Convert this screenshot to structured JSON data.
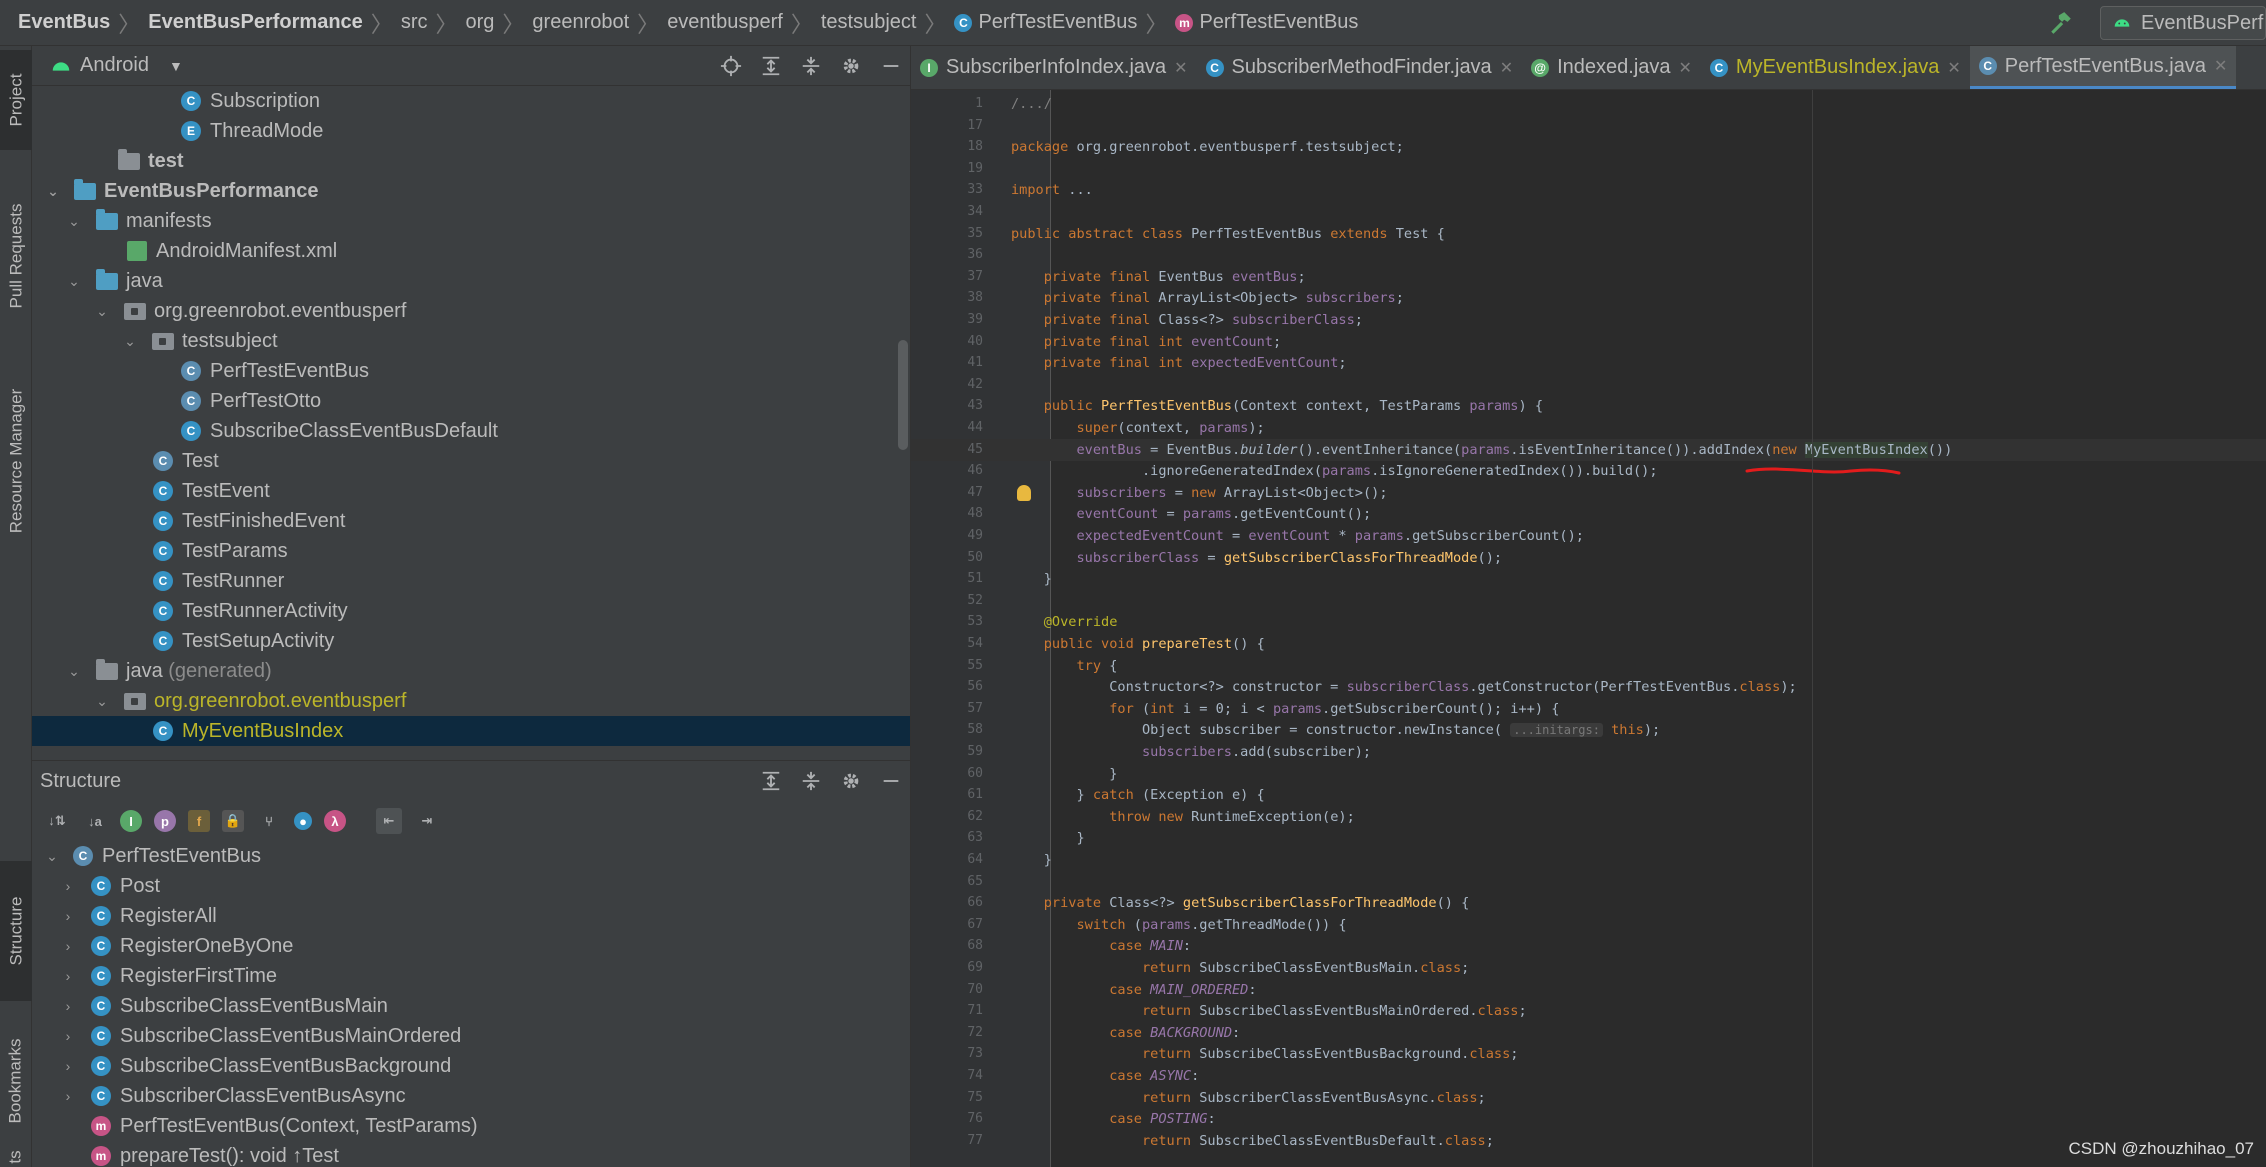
{
  "breadcrumb": [
    "EventBus",
    "EventBusPerformance",
    "src",
    "org",
    "greenrobot",
    "eventbusperf",
    "testsubject",
    "PerfTestEventBus",
    "PerfTestEventBus"
  ],
  "run_config": "EventBusPerf",
  "side_tabs": {
    "project": "Project",
    "pull_requests": "Pull Requests",
    "resource_manager": "Resource Manager",
    "structure": "Structure",
    "bookmarks": "Bookmarks",
    "bottom": "ts"
  },
  "project": {
    "view_mode": "Android",
    "tree": [
      {
        "label": "Subscription",
        "icon": "class-icon"
      },
      {
        "label": "ThreadMode",
        "icon": "class-icon"
      },
      {
        "label": "test",
        "icon": "folder-icon"
      },
      {
        "label": "EventBusPerformance",
        "icon": "module-icon"
      },
      {
        "label": "manifests",
        "icon": "folder-icon"
      },
      {
        "label": "AndroidManifest.xml",
        "icon": "manifest-icon"
      },
      {
        "label": "java",
        "icon": "folder-icon"
      },
      {
        "label": "org.greenrobot.eventbusperf",
        "icon": "package-icon"
      },
      {
        "label": "testsubject",
        "icon": "package-icon"
      },
      {
        "label": "PerfTestEventBus",
        "icon": "abstract-class-icon"
      },
      {
        "label": "PerfTestOtto",
        "icon": "abstract-class-icon"
      },
      {
        "label": "SubscribeClassEventBusDefault",
        "icon": "class-icon"
      },
      {
        "label": "Test",
        "icon": "abstract-class-icon"
      },
      {
        "label": "TestEvent",
        "icon": "class-icon"
      },
      {
        "label": "TestFinishedEvent",
        "icon": "class-icon"
      },
      {
        "label": "TestParams",
        "icon": "class-icon"
      },
      {
        "label": "TestRunner",
        "icon": "class-icon"
      },
      {
        "label": "TestRunnerActivity",
        "icon": "class-icon"
      },
      {
        "label": "TestSetupActivity",
        "icon": "class-icon"
      },
      {
        "label": "java",
        "suffix": "(generated)",
        "icon": "generated-folder-icon"
      },
      {
        "label": "org.greenrobot.eventbusperf",
        "icon": "package-icon"
      },
      {
        "label": "MyEventBusIndex",
        "icon": "class-icon"
      }
    ]
  },
  "structure": {
    "title": "Structure",
    "tree": [
      {
        "label": "PerfTestEventBus",
        "icon": "abstract-class-icon"
      },
      {
        "label": "Post",
        "icon": "class-icon"
      },
      {
        "label": "RegisterAll",
        "icon": "class-icon"
      },
      {
        "label": "RegisterOneByOne",
        "icon": "class-icon"
      },
      {
        "label": "RegisterFirstTime",
        "icon": "class-icon"
      },
      {
        "label": "SubscribeClassEventBusMain",
        "icon": "class-icon"
      },
      {
        "label": "SubscribeClassEventBusMainOrdered",
        "icon": "class-icon"
      },
      {
        "label": "SubscribeClassEventBusBackground",
        "icon": "class-icon"
      },
      {
        "label": "SubscriberClassEventBusAsync",
        "icon": "class-icon"
      },
      {
        "label": "PerfTestEventBus(Context, TestParams)",
        "icon": "method-icon"
      },
      {
        "label": "prepareTest(): void ↑Test",
        "icon": "method-icon"
      }
    ]
  },
  "tabs": [
    {
      "label": "SubscriberInfoIndex.java",
      "icon": "interface-icon"
    },
    {
      "label": "SubscriberMethodFinder.java",
      "icon": "class-icon"
    },
    {
      "label": "Indexed.java",
      "icon": "annotation-icon"
    },
    {
      "label": "MyEventBusIndex.java",
      "icon": "class-icon",
      "modified": true
    },
    {
      "label": "PerfTestEventBus.java",
      "icon": "abstract-class-icon",
      "active": true
    }
  ],
  "code_lines": [
    {
      "n": "1",
      "text": "/.../"
    },
    {
      "n": "17",
      "text": ""
    },
    {
      "n": "18",
      "text": "package org.greenrobot.eventbusperf.testsubject;"
    },
    {
      "n": "19",
      "text": ""
    },
    {
      "n": "33",
      "text": "import ..."
    },
    {
      "n": "34",
      "text": ""
    },
    {
      "n": "35",
      "text": "public abstract class PerfTestEventBus extends Test {"
    },
    {
      "n": "36",
      "text": ""
    },
    {
      "n": "37",
      "text": "    private final EventBus eventBus;"
    },
    {
      "n": "38",
      "text": "    private final ArrayList<Object> subscribers;"
    },
    {
      "n": "39",
      "text": "    private final Class<?> subscriberClass;"
    },
    {
      "n": "40",
      "text": "    private final int eventCount;"
    },
    {
      "n": "41",
      "text": "    private final int expectedEventCount;"
    },
    {
      "n": "42",
      "text": ""
    },
    {
      "n": "43",
      "text": "    public PerfTestEventBus(Context context, TestParams params) {"
    },
    {
      "n": "44",
      "text": "        super(context, params);"
    },
    {
      "n": "45",
      "text": "        eventBus = EventBus.builder().eventInheritance(params.isEventInheritance()).addIndex(new MyEventBusIndex())"
    },
    {
      "n": "46",
      "text": "                .ignoreGeneratedIndex(params.isIgnoreGeneratedIndex()).build();"
    },
    {
      "n": "47",
      "text": "        subscribers = new ArrayList<Object>();"
    },
    {
      "n": "48",
      "text": "        eventCount = params.getEventCount();"
    },
    {
      "n": "49",
      "text": "        expectedEventCount = eventCount * params.getSubscriberCount();"
    },
    {
      "n": "50",
      "text": "        subscriberClass = getSubscriberClassForThreadMode();"
    },
    {
      "n": "51",
      "text": "    }"
    },
    {
      "n": "52",
      "text": ""
    },
    {
      "n": "53",
      "text": "    @Override"
    },
    {
      "n": "54",
      "text": "    public void prepareTest() {"
    },
    {
      "n": "55",
      "text": "        try {"
    },
    {
      "n": "56",
      "text": "            Constructor<?> constructor = subscriberClass.getConstructor(PerfTestEventBus.class);"
    },
    {
      "n": "57",
      "text": "            for (int i = 0; i < params.getSubscriberCount(); i++) {"
    },
    {
      "n": "58",
      "text": "                Object subscriber = constructor.newInstance( ...initargs: this);"
    },
    {
      "n": "59",
      "text": "                subscribers.add(subscriber);"
    },
    {
      "n": "60",
      "text": "            }"
    },
    {
      "n": "61",
      "text": "        } catch (Exception e) {"
    },
    {
      "n": "62",
      "text": "            throw new RuntimeException(e);"
    },
    {
      "n": "63",
      "text": "        }"
    },
    {
      "n": "64",
      "text": "    }"
    },
    {
      "n": "65",
      "text": ""
    },
    {
      "n": "66",
      "text": "    private Class<?> getSubscriberClassForThreadMode() {"
    },
    {
      "n": "67",
      "text": "        switch (params.getThreadMode()) {"
    },
    {
      "n": "68",
      "text": "            case MAIN:"
    },
    {
      "n": "69",
      "text": "                return SubscribeClassEventBusMain.class;"
    },
    {
      "n": "70",
      "text": "            case MAIN_ORDERED:"
    },
    {
      "n": "71",
      "text": "                return SubscribeClassEventBusMainOrdered.class;"
    },
    {
      "n": "72",
      "text": "            case BACKGROUND:"
    },
    {
      "n": "73",
      "text": "                return SubscribeClassEventBusBackground.class;"
    },
    {
      "n": "74",
      "text": "            case ASYNC:"
    },
    {
      "n": "75",
      "text": "                return SubscriberClassEventBusAsync.class;"
    },
    {
      "n": "76",
      "text": "            case POSTING:"
    },
    {
      "n": "77",
      "text": "                return SubscribeClassEventBusDefault.class;"
    }
  ],
  "watermark": "CSDN @zhouzhihao_07",
  "colors": {
    "accent": "#4a88c7",
    "annotation_underline": "#e31c1c",
    "class_icon": "#3592c4",
    "method_icon": "#c75486"
  }
}
